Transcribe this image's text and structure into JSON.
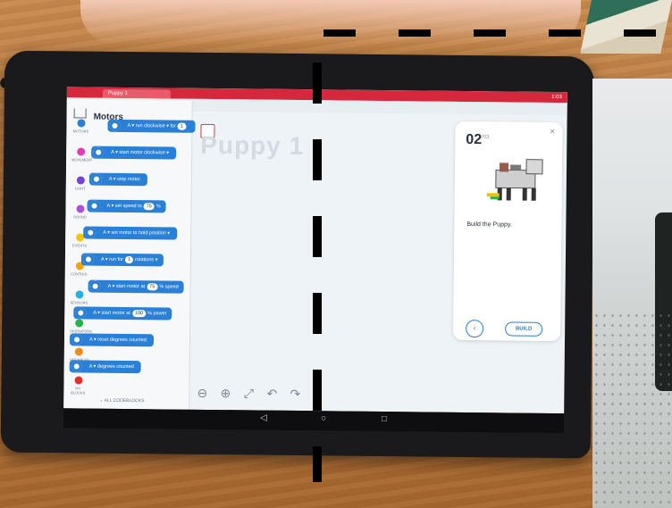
{
  "scene": {
    "browser_tab": "Puppy 1",
    "status_time": "1:03"
  },
  "palette": {
    "title": "Motors",
    "categories": [
      {
        "label": "MOTORS",
        "color": "#2a7fd6"
      },
      {
        "label": "MOVEMENT",
        "color": "#e23ab0"
      },
      {
        "label": "LIGHT",
        "color": "#7a3fd6"
      },
      {
        "label": "SOUND",
        "color": "#b04fd6"
      },
      {
        "label": "EVENTS",
        "color": "#f5c400"
      },
      {
        "label": "CONTROL",
        "color": "#f0a500"
      },
      {
        "label": "SENSORS",
        "color": "#2ab0e0"
      },
      {
        "label": "OPERATORS",
        "color": "#27b24a"
      },
      {
        "label": "VARIABLES",
        "color": "#f08a1a"
      },
      {
        "label": "MY BLOCKS",
        "color": "#e03030"
      }
    ],
    "blocks": [
      {
        "text": "A ▾  run  clockwise ▾  for",
        "pill": "1"
      },
      {
        "text": "A ▾  start motor  clockwise ▾",
        "pill": ""
      },
      {
        "text": "A ▾  stop motor",
        "pill": ""
      },
      {
        "text": "A ▾  set speed to",
        "pill": "75",
        "suffix": "%"
      },
      {
        "text": "A ▾  set motor to  hold position ▾",
        "pill": ""
      },
      {
        "text": "A ▾  run for",
        "pill": "1",
        "suffix": "rotations ▾"
      },
      {
        "text": "A ▾  start motor at",
        "pill": "75",
        "suffix": "% speed"
      },
      {
        "text": "A ▾  start motor at",
        "pill": "100",
        "suffix": "% power"
      },
      {
        "text": "A ▾  reset degrees counted",
        "pill": ""
      },
      {
        "text": "A ▾  degrees counted",
        "pill": ""
      }
    ],
    "all_codeblocks": "ALL CODEBLOCKS"
  },
  "canvas": {
    "project_title": "Puppy 1",
    "tools": [
      "⊖",
      "⊕",
      "⤢",
      "↶",
      "↷"
    ]
  },
  "card": {
    "step": "02",
    "step_total": "/03",
    "instruction": "Build the Puppy.",
    "build_label": "BUILD",
    "prev_glyph": "‹",
    "next_glyph": "›"
  },
  "navbar": {
    "back": "◁",
    "home": "○",
    "recents": "□"
  }
}
